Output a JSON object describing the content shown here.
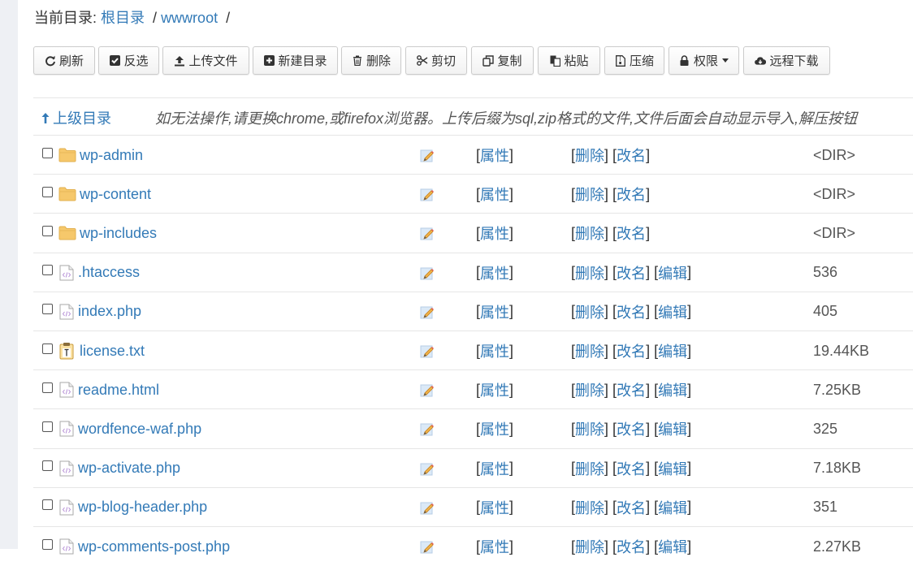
{
  "breadcrumb": {
    "label": "当前目录:",
    "root": "根目录",
    "sep1": "/",
    "current": "wwwroot",
    "sep2": "/"
  },
  "toolbar": {
    "refresh": "刷新",
    "invert": "反选",
    "upload": "上传文件",
    "new_dir": "新建目录",
    "delete": "删除",
    "cut": "剪切",
    "copy": "复制",
    "paste": "粘贴",
    "compress": "压缩",
    "permission": "权限",
    "remote_download": "远程下载"
  },
  "list": {
    "parent_dir": "上级目录",
    "notice": "如无法操作,请更换chrome,或firefox浏览器。上传后缀为sql,zip格式的文件,文件后面会自动显示导入,解压按钮",
    "prop_label": "属性",
    "delete_label": "删除",
    "rename_label": "改名",
    "edit_label": "编辑",
    "rows": [
      {
        "name": "wp-admin",
        "type": "folder",
        "size": "<DIR>"
      },
      {
        "name": "wp-content",
        "type": "folder",
        "size": "<DIR>"
      },
      {
        "name": "wp-includes",
        "type": "folder",
        "size": "<DIR>"
      },
      {
        "name": ".htaccess",
        "type": "code",
        "size": "536"
      },
      {
        "name": "index.php",
        "type": "code",
        "size": "405"
      },
      {
        "name": "license.txt",
        "type": "text",
        "size": "19.44KB"
      },
      {
        "name": "readme.html",
        "type": "code",
        "size": "7.25KB"
      },
      {
        "name": "wordfence-waf.php",
        "type": "code",
        "size": "325"
      },
      {
        "name": "wp-activate.php",
        "type": "code",
        "size": "7.18KB"
      },
      {
        "name": "wp-blog-header.php",
        "type": "code",
        "size": "351"
      },
      {
        "name": "wp-comments-post.php",
        "type": "code",
        "size": "2.27KB"
      }
    ]
  }
}
